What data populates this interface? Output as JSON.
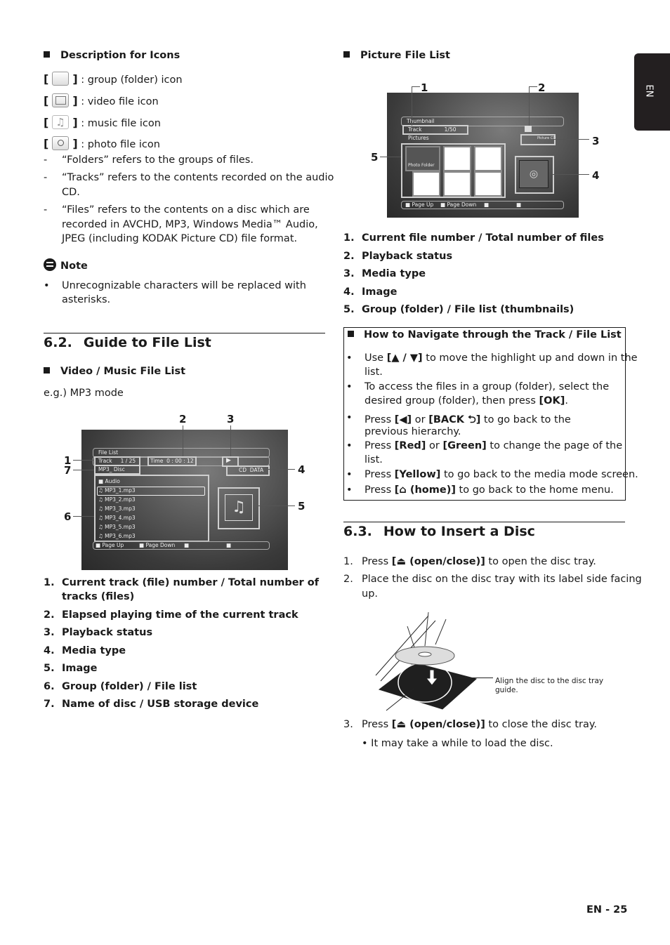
{
  "side_tab": {
    "label": "EN"
  },
  "icons_section": {
    "heading": "Description for Icons",
    "items": [
      {
        "icon": "folder-icon",
        "label": ": group (folder) icon"
      },
      {
        "icon": "video-file-icon",
        "label": ": video file icon"
      },
      {
        "icon": "music-file-icon",
        "label": ": music file icon"
      },
      {
        "icon": "photo-file-icon",
        "label": ": photo file icon"
      }
    ],
    "definitions": [
      {
        "lines": [
          "“Folders” refers to the groups of files."
        ]
      },
      {
        "lines": [
          "“Tracks” refers to the contents recorded on the audio",
          "CD."
        ]
      },
      {
        "lines": [
          "“Files” refers to the contents on a disc which are",
          "recorded in AVCHD, MP3, Windows Media™ Audio,",
          "JPEG (including KODAK Picture CD) file format."
        ]
      }
    ]
  },
  "note": {
    "title": "Note",
    "lines": [
      "Unrecognizable characters will be replaced with",
      "asterisks."
    ]
  },
  "section_62": {
    "number": "6.2.",
    "title": "Guide to File List",
    "subheading": "Video / Music File List",
    "example": "e.g.) MP3 mode",
    "screen": {
      "title": "File List",
      "track_label": "Track",
      "track_value": "1 / 25",
      "time_label": "Time",
      "time_value": "0 : 00 : 12",
      "disc_name": "MP3_ Disc",
      "media": [
        "CD",
        "DATA"
      ],
      "folder": "Audio",
      "files": [
        "MP3_1.mp3",
        "MP3_2.mp3",
        "MP3_3.mp3",
        "MP3_4.mp3",
        "MP3_5.mp3",
        "MP3_6.mp3"
      ],
      "footer": [
        "Page Up",
        "Page Down",
        "",
        ""
      ]
    },
    "callouts": [
      "1",
      "2",
      "3",
      "4",
      "5",
      "6",
      "7"
    ],
    "legend": [
      {
        "num": "1.",
        "lines": [
          "Current track (file) number / Total number of",
          "tracks (files)"
        ]
      },
      {
        "num": "2.",
        "lines": [
          "Elapsed playing time of the current track"
        ]
      },
      {
        "num": "3.",
        "lines": [
          "Playback status"
        ]
      },
      {
        "num": "4.",
        "lines": [
          "Media type"
        ]
      },
      {
        "num": "5.",
        "lines": [
          "Image"
        ]
      },
      {
        "num": "6.",
        "lines": [
          "Group (folder) / File list"
        ]
      },
      {
        "num": "7.",
        "lines": [
          "Name of disc / USB storage device"
        ]
      }
    ]
  },
  "picture_list": {
    "subheading": "Picture File List",
    "screen": {
      "title": "Thumbnail",
      "track_label": "Track",
      "track_value": "1/50",
      "folder_label": "Pictures",
      "media": "Picture CD",
      "photo_folder": "Photo Folder",
      "footer": [
        "Page Up",
        "Page Down",
        "",
        ""
      ]
    },
    "callouts": [
      "1",
      "2",
      "3",
      "4",
      "5"
    ],
    "legend": [
      {
        "num": "1.",
        "text": "Current file number / Total number of files"
      },
      {
        "num": "2.",
        "text": "Playback status"
      },
      {
        "num": "3.",
        "text": "Media type"
      },
      {
        "num": "4.",
        "text": "Image"
      },
      {
        "num": "5.",
        "text": "Group (folder) / File list (thumbnails)"
      }
    ]
  },
  "navigate": {
    "heading": "How to Navigate through the Track / File List",
    "items": [
      {
        "pre": "Use ",
        "key": "[▲ / ▼]",
        "post": " to move the highlight up and down in the",
        "cont": "list."
      },
      {
        "pre": "To access the files in a group (folder), select the",
        "key": "",
        "post": "",
        "cont2pre": "desired group (folder), then press ",
        "cont2key": "[OK]",
        "cont2post": "."
      },
      {
        "pre": "Press ",
        "key": "[◀]",
        "mid": " or ",
        "key2": "[BACK ⮌]",
        "post": " to go back to the",
        "cont": "previous hierarchy."
      },
      {
        "pre": "Press ",
        "key": "[Red]",
        "mid": " or ",
        "key2": "[Green]",
        "post": " to change the page of the",
        "cont": "list."
      },
      {
        "pre": "Press ",
        "key": "[Yellow]",
        "post": " to go back to the media mode screen."
      },
      {
        "pre": "Press ",
        "key": "[⌂ (home)]",
        "post": " to go back to the home menu."
      }
    ]
  },
  "section_63": {
    "number": "6.3.",
    "title": "How to Insert a Disc",
    "steps": [
      {
        "num": "1.",
        "pre": "Press ",
        "key": "[⏏ (open/close)]",
        "post": " to open the disc tray."
      },
      {
        "num": "2.",
        "pre": "Place the disc on the disc tray with its label side facing",
        "cont": "up."
      },
      {
        "num": "3.",
        "pre": "Press ",
        "key": "[⏏ (open/close)]",
        "post": " to close the disc tray."
      }
    ],
    "sub_bullet": "It may take a while to load the disc.",
    "illustration_caption": [
      "Align the disc to the disc tray",
      "guide."
    ]
  },
  "footer": {
    "page": "EN - 25"
  }
}
